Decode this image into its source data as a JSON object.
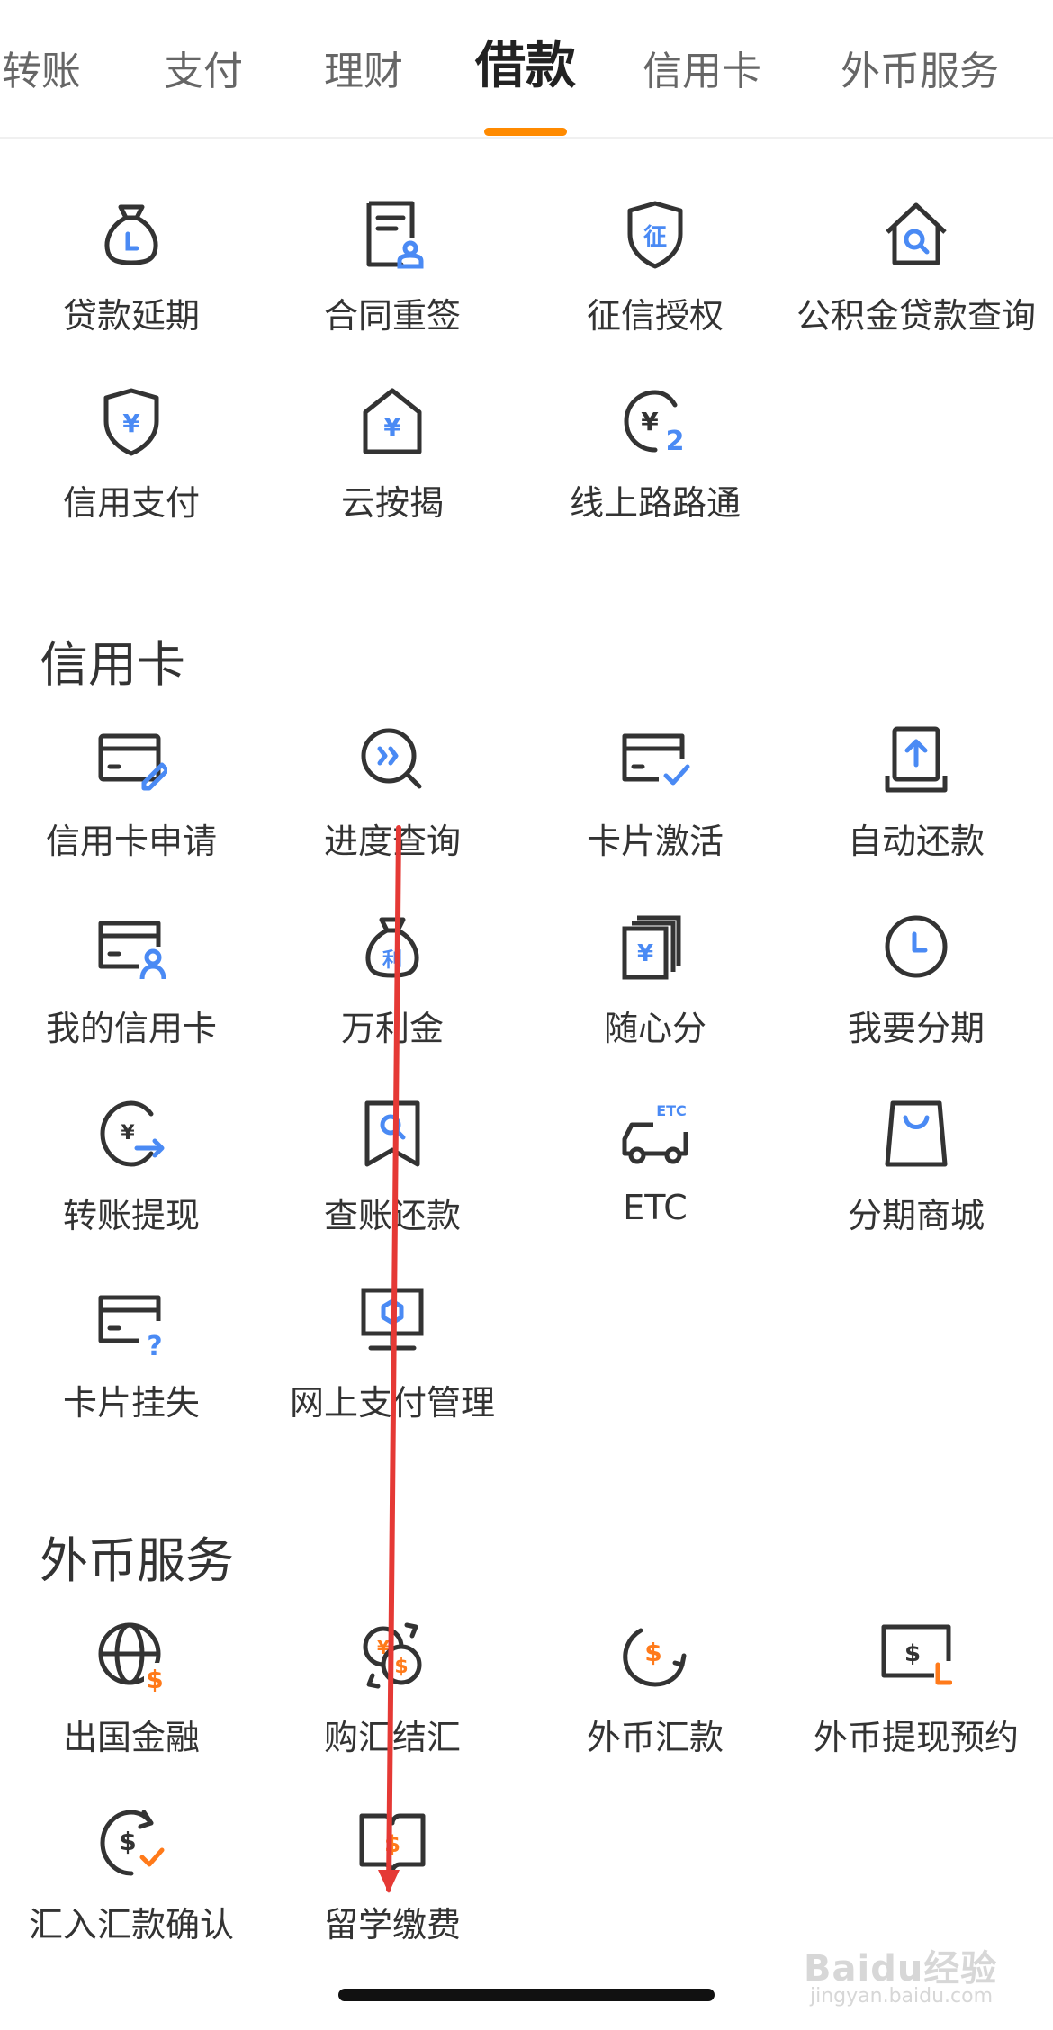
{
  "tabs": [
    {
      "label": "转账"
    },
    {
      "label": "支付"
    },
    {
      "label": "理财"
    },
    {
      "label": "借款",
      "active": true
    },
    {
      "label": "信用卡"
    },
    {
      "label": "外币服务"
    }
  ],
  "loans": {
    "items": [
      {
        "label": "贷款延期",
        "icon": "money-bag-icon"
      },
      {
        "label": "合同重签",
        "icon": "contract-icon"
      },
      {
        "label": "征信授权",
        "icon": "credit-shield-icon"
      },
      {
        "label": "公积金贷款查询",
        "icon": "house-search-icon"
      },
      {
        "label": "信用支付",
        "icon": "yuan-shield-icon"
      },
      {
        "label": "云按揭",
        "icon": "yuan-house-icon"
      },
      {
        "label": "线上路路通",
        "icon": "yuan-cycle-icon"
      }
    ]
  },
  "credit_card": {
    "title": "信用卡",
    "items": [
      {
        "label": "信用卡申请",
        "icon": "card-edit-icon"
      },
      {
        "label": "进度查询",
        "icon": "progress-search-icon"
      },
      {
        "label": "卡片激活",
        "icon": "card-check-icon"
      },
      {
        "label": "自动还款",
        "icon": "auto-repay-icon"
      },
      {
        "label": "我的信用卡",
        "icon": "card-user-icon"
      },
      {
        "label": "万利金",
        "icon": "interest-bag-icon"
      },
      {
        "label": "随心分",
        "icon": "yuan-notes-icon"
      },
      {
        "label": "我要分期",
        "icon": "clock-icon"
      },
      {
        "label": "转账提现",
        "icon": "transfer-withdraw-icon"
      },
      {
        "label": "查账还款",
        "icon": "bill-search-icon"
      },
      {
        "label": "ETC",
        "icon": "etc-car-icon"
      },
      {
        "label": "分期商城",
        "icon": "shopping-bag-icon"
      },
      {
        "label": "卡片挂失",
        "icon": "card-question-icon"
      },
      {
        "label": "网上支付管理",
        "icon": "monitor-icon"
      }
    ]
  },
  "forex": {
    "title": "外币服务",
    "items": [
      {
        "label": "出国金融",
        "icon": "globe-dollar-icon"
      },
      {
        "label": "购汇结汇",
        "icon": "currency-exchange-icon"
      },
      {
        "label": "外币汇款",
        "icon": "dollar-send-icon"
      },
      {
        "label": "外币提现预约",
        "icon": "dollar-screen-icon"
      },
      {
        "label": "汇入汇款确认",
        "icon": "dollar-confirm-icon"
      },
      {
        "label": "留学缴费",
        "icon": "study-fee-icon"
      }
    ]
  },
  "watermark": {
    "brand": "Baidu经验",
    "url": "jingyan.baidu.com"
  },
  "colors": {
    "accent": "#ff8a00",
    "icon_dark": "#333333",
    "icon_blue": "#4a8af4",
    "icon_orange": "#ff7a1a",
    "annotation_red": "#e53935"
  }
}
